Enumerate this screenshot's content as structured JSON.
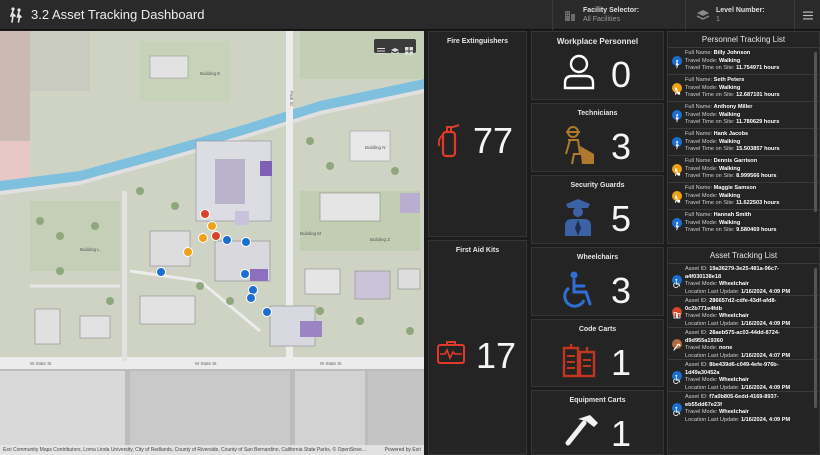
{
  "header": {
    "title": "3.2 Asset Tracking Dashboard",
    "facility_label": "Facility Selector:",
    "facility_value": "All Facilities",
    "level_label": "Level Number:",
    "level_value": "1"
  },
  "map": {
    "labels": {
      "building_e": "Building E",
      "building_l": "Building L",
      "building_n": "Building N",
      "building_m": "Building M",
      "building_z": "Building Z",
      "state_st_1": "W State St",
      "state_st_2": "W State St",
      "state_st_3": "W State St",
      "park_st": "Park St"
    },
    "attribution": "Esri Community Maps Contributors, Loma Linda University, City of Redlands, County of Riverside, County of San Bernardino, California State Parks, © OpenStree...",
    "powered_by": "Powered by Esri"
  },
  "indicators": {
    "fire_extinguishers": {
      "title": "Fire Extinguishers",
      "value": "77"
    },
    "first_aid_kits": {
      "title": "First Aid Kits",
      "value": "17"
    },
    "workplace_personnel": {
      "title": "Workplace Personnel",
      "value": "0"
    },
    "technicians": {
      "title": "Technicians",
      "value": "3"
    },
    "security_guards": {
      "title": "Security Guards",
      "value": "5"
    },
    "wheelchairs": {
      "title": "Wheelchairs",
      "value": "3"
    },
    "code_carts": {
      "title": "Code Carts",
      "value": "1"
    },
    "equipment_carts": {
      "title": "Equipment Carts",
      "value": "1"
    }
  },
  "personnel_list": {
    "title": "Personnel Tracking List",
    "labels": {
      "name": "Full Name: ",
      "mode": "Travel Mode: ",
      "time": "Travel Time on Site: "
    },
    "items": [
      {
        "name": "Billy Johnson",
        "mode": "Walking",
        "time": "11.754971 hours",
        "icon": "walking-icon",
        "color": "#1c6fd1"
      },
      {
        "name": "Seth Peters",
        "mode": "Walking",
        "time": "12.687101 hours",
        "icon": "worker-icon",
        "color": "#f0a019"
      },
      {
        "name": "Anthony Miller",
        "mode": "Walking",
        "time": "11.780629 hours",
        "icon": "walking-icon",
        "color": "#1c6fd1"
      },
      {
        "name": "Hank Jacobs",
        "mode": "Walking",
        "time": "15.503857 hours",
        "icon": "walking-icon",
        "color": "#1c6fd1"
      },
      {
        "name": "Dennis Garrison",
        "mode": "Walking",
        "time": "8.999566 hours",
        "icon": "worker-icon",
        "color": "#f0a019"
      },
      {
        "name": "Maggie Samson",
        "mode": "Walking",
        "time": "11.622503 hours",
        "icon": "worker-icon",
        "color": "#f0a019"
      },
      {
        "name": "Hannah Smith",
        "mode": "Walking",
        "time": "9.580469 hours",
        "icon": "walking-icon",
        "color": "#1c6fd1"
      }
    ]
  },
  "asset_list": {
    "title": "Asset Tracking List",
    "labels": {
      "id": "Asset ID: ",
      "mode": "Travel Mode: ",
      "update": "Location Last Update: "
    },
    "items": [
      {
        "id_line1": "19a36279-3e25-481a-96c7-",
        "id_line2": "a4f030138e18",
        "mode": "Wheelchair",
        "update": "1/16/2024, 4:09 PM",
        "icon": "wheelchair-icon",
        "color": "#1c6fd1"
      },
      {
        "id_line1": "286657d2-cdfe-43df-afd8-",
        "id_line2": "0c2b771e4fdb",
        "mode": "Wheelchair",
        "update": "1/16/2024, 4:09 PM",
        "icon": "code-cart-icon",
        "color": "#d5452b"
      },
      {
        "id_line1": "28aeb575-ac03-44dd-8724-",
        "id_line2": "d9d955a19360",
        "mode": "none",
        "update": "1/16/2024, 4:07 PM",
        "icon": "hammer-icon",
        "color": "#b36a3c"
      },
      {
        "id_line1": "8be439d6-c049-4efe-976b-",
        "id_line2": "1d49a30452a",
        "mode": "Wheelchair",
        "update": "1/16/2024, 4:09 PM",
        "icon": "wheelchair-icon",
        "color": "#1c6fd1"
      },
      {
        "id_line1": "f7a0b805-6edd-4169-8937-",
        "id_line2": "eb55dd67e23f",
        "mode": "Wheelchair",
        "update": "1/16/2024, 4:09 PM",
        "icon": "wheelchair-icon",
        "color": "#1c6fd1"
      }
    ]
  },
  "colors": {
    "fire": "#e23a2a",
    "first_aid": "#e23a2a",
    "personnel": "#ffffff",
    "technician": "#b07a2e",
    "security": "#3c62a6",
    "wheelchair": "#2f6fd6",
    "code_cart": "#c2361f",
    "equipment": "#f2f2f2"
  }
}
